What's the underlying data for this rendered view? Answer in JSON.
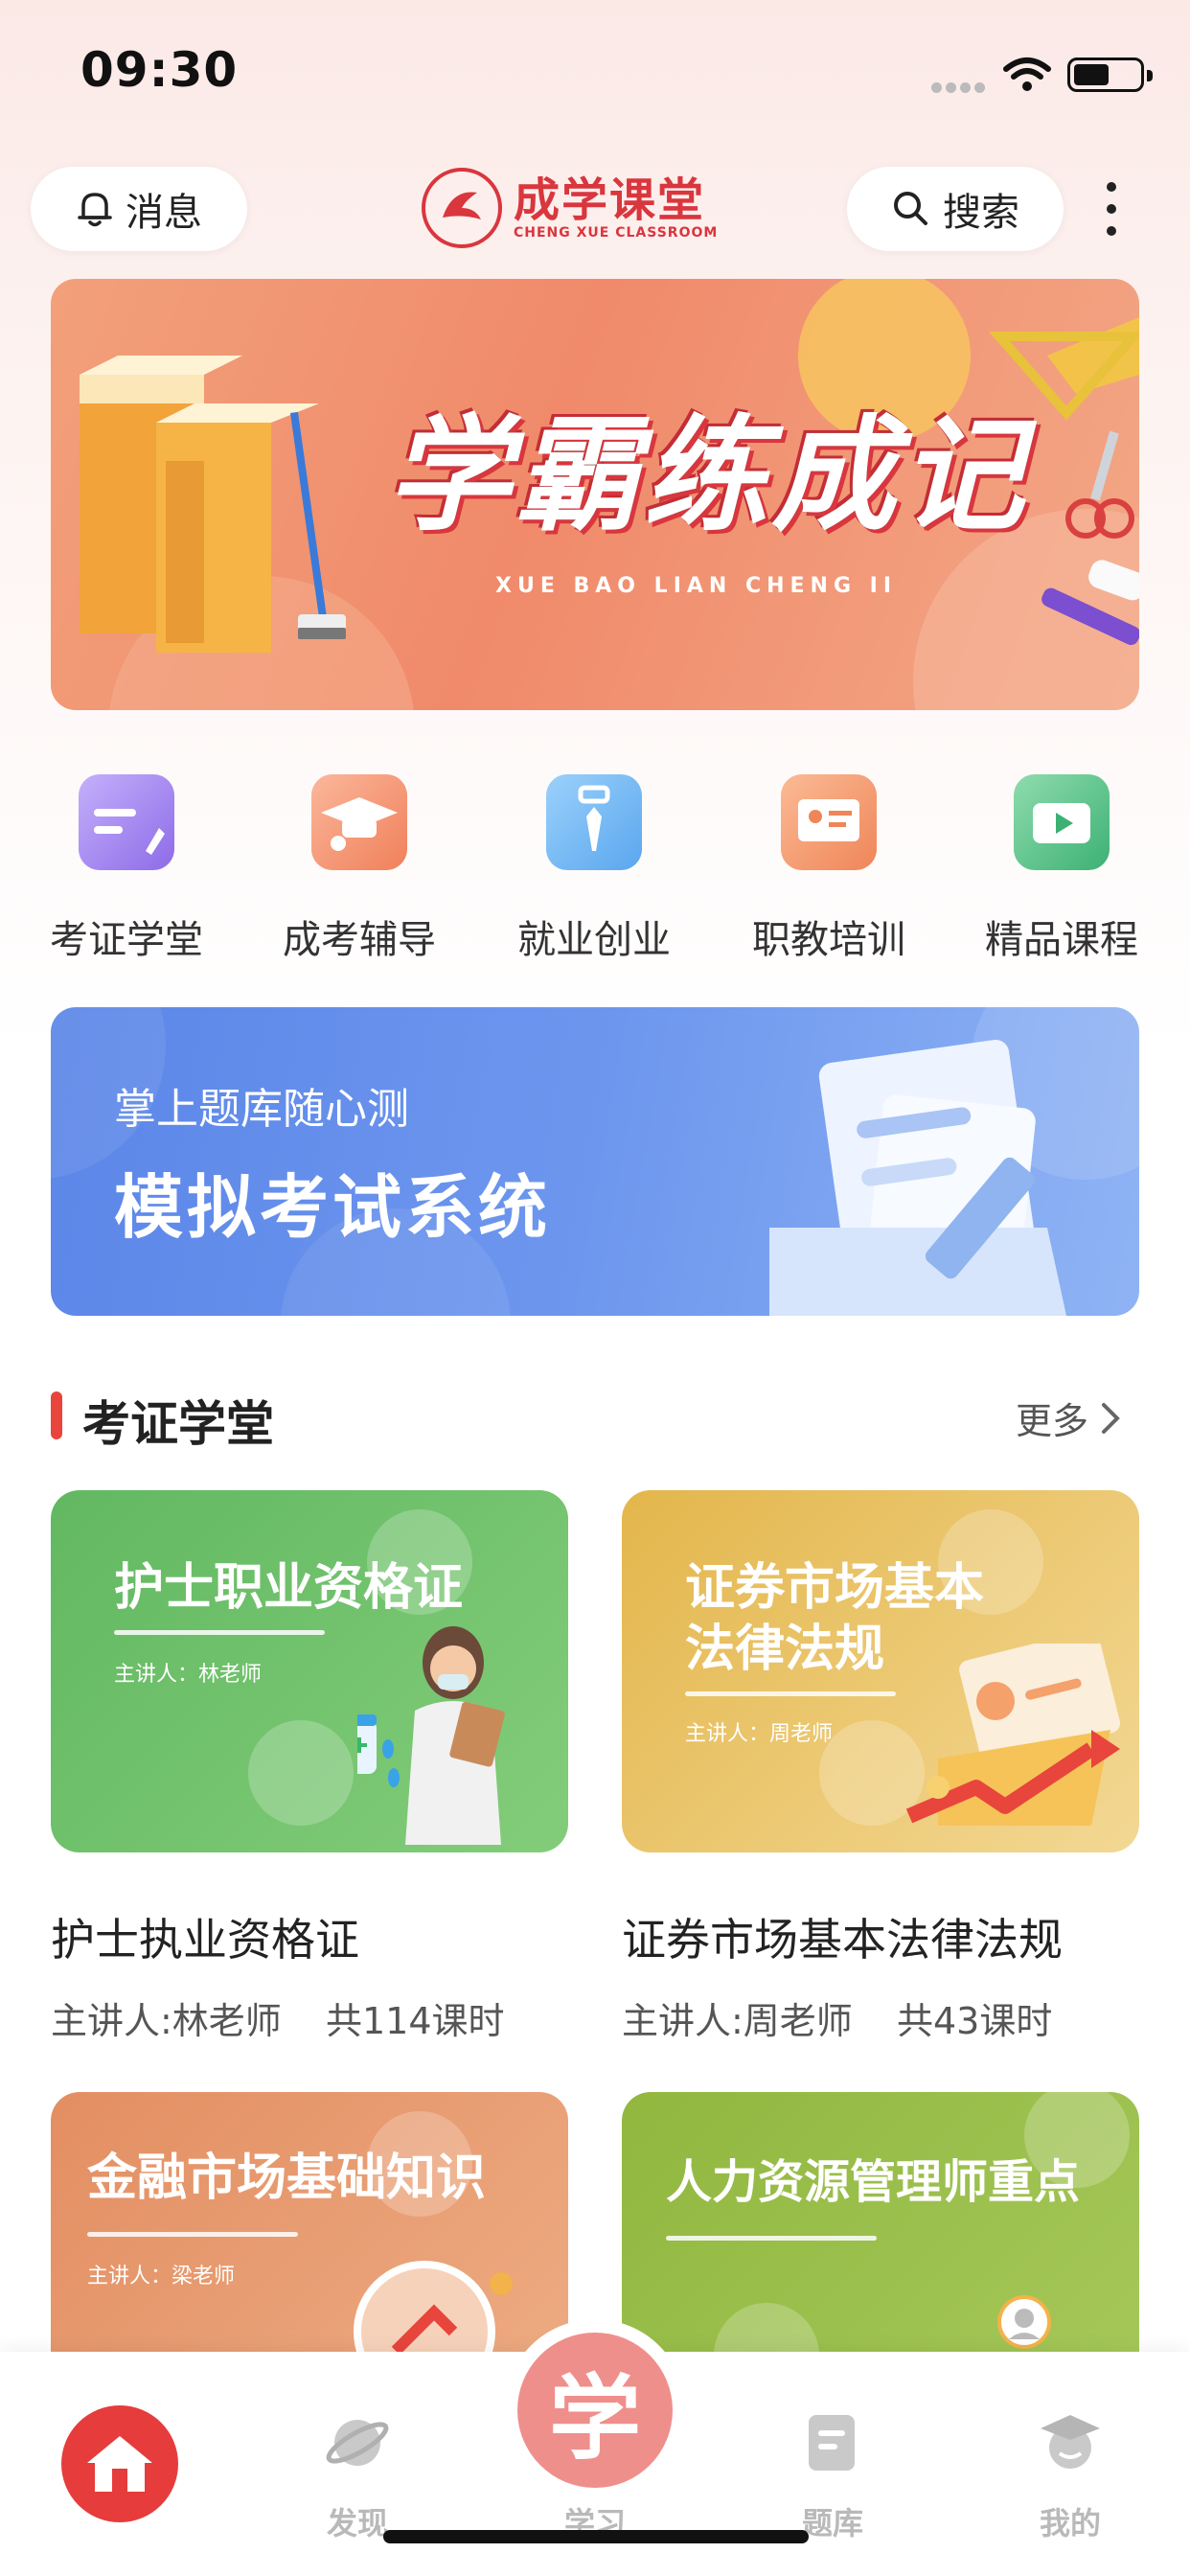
{
  "status_bar": {
    "time": "09:30"
  },
  "header": {
    "message_label": "消息",
    "search_label": "搜索",
    "logo_cn": "成学课堂",
    "logo_en": "CHENG XUE CLASSROOM"
  },
  "hero_banner": {
    "title": "学霸练成记",
    "subtitle": "XUE BAO LIAN CHENG II"
  },
  "categories": [
    {
      "label": "考证学堂",
      "icon": "certificate-pen-icon",
      "color": "#a486f0"
    },
    {
      "label": "成考辅导",
      "icon": "graduation-cap-icon",
      "color": "#f3906e"
    },
    {
      "label": "就业创业",
      "icon": "briefcase-tie-icon",
      "color": "#6cb6f0"
    },
    {
      "label": "职教培训",
      "icon": "id-card-icon",
      "color": "#f39a6d"
    },
    {
      "label": "精品课程",
      "icon": "video-play-icon",
      "color": "#5cc48a"
    }
  ],
  "exam_banner": {
    "subtitle": "掌上题库随心测",
    "title": "模拟考试系统"
  },
  "section": {
    "title": "考证学堂",
    "more_label": "更多"
  },
  "courses": [
    {
      "card_title": "护士职业资格证",
      "card_teacher": "主讲人：林老师",
      "name": "护士执业资格证",
      "teacher": "主讲人:林老师",
      "lessons": "共114课时",
      "color": "#6cc06a"
    },
    {
      "card_title": "证券市场基本\n法律法规",
      "card_teacher": "主讲人：周老师",
      "name": "证券市场基本法律法规",
      "teacher": "主讲人:周老师",
      "lessons": "共43课时",
      "color": "#e9be5c"
    },
    {
      "card_title": "金融市场基础知识",
      "card_teacher": "主讲人：梁老师",
      "color": "#e69a70"
    },
    {
      "card_title": "人力资源管理师重点",
      "color": "#9bbf4c"
    }
  ],
  "tabbar": {
    "items": [
      {
        "label": "首页",
        "icon": "home-icon",
        "active": true
      },
      {
        "label": "发现",
        "icon": "planet-icon"
      },
      {
        "label": "学习",
        "icon": "learn-icon",
        "glyph": "学"
      },
      {
        "label": "题库",
        "icon": "question-bank-icon"
      },
      {
        "label": "我的",
        "icon": "profile-icon"
      }
    ]
  },
  "colors": {
    "accent": "#e8453c",
    "home_active": "#e63c3c"
  }
}
